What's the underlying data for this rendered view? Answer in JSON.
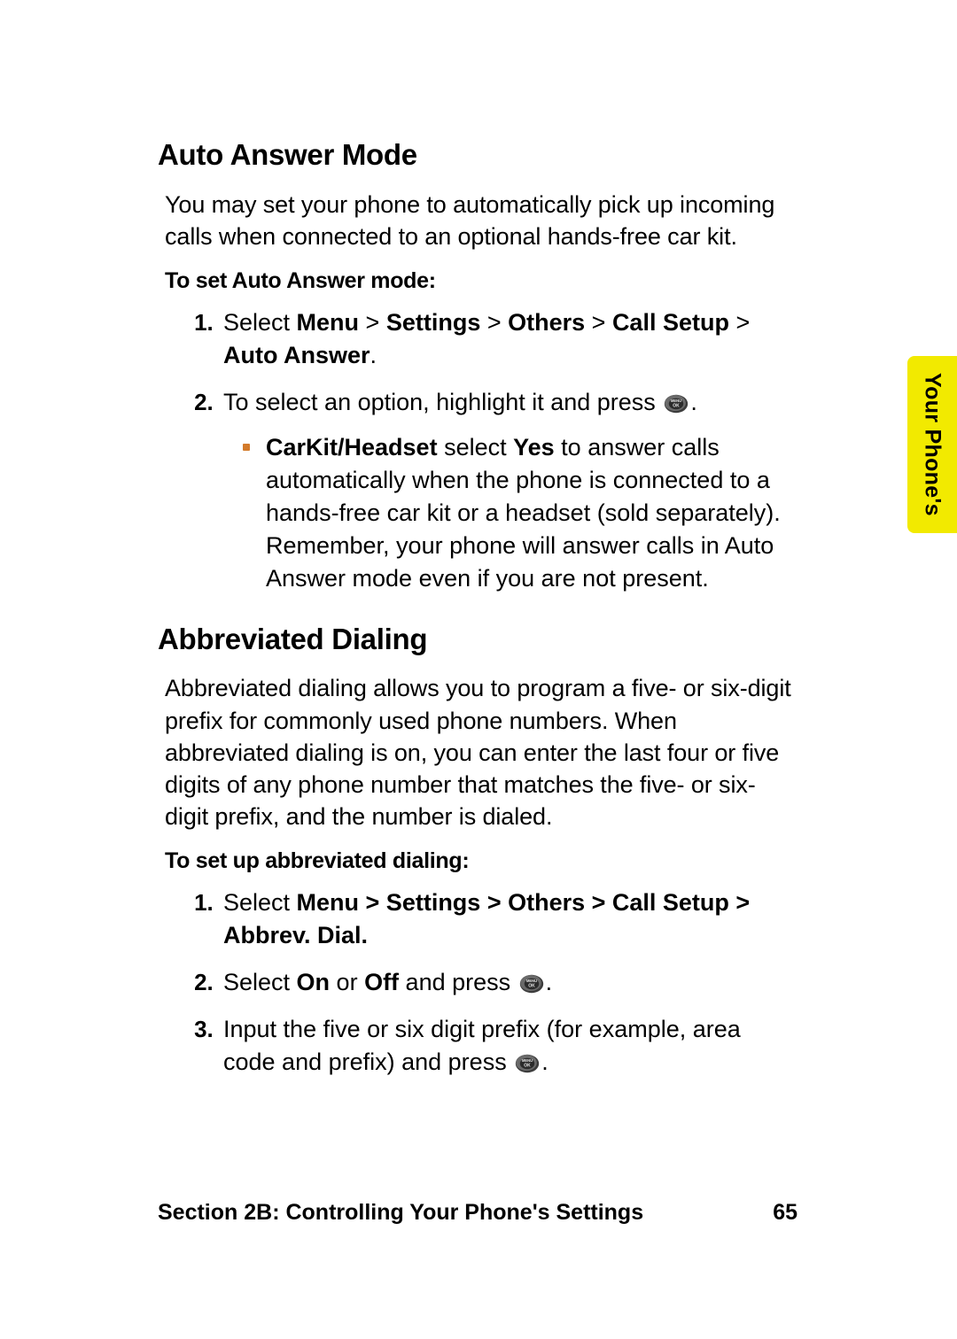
{
  "sideTab": {
    "label": "Your Phone's"
  },
  "section1": {
    "heading": "Auto Answer Mode",
    "intro": "You may set your phone to automatically pick up incoming calls when connected to an optional hands-free car kit.",
    "taskHeading": "To set Auto Answer mode:",
    "step1": {
      "pre": "Select ",
      "b1": "Menu",
      "b2": "Settings",
      "b3": "Others",
      "b4": "Call Setup",
      "b5": "Auto Answer",
      "dot": "."
    },
    "step2": {
      "pre": "To select an option, highlight it and press ",
      "post": "."
    },
    "bullet": {
      "b1": "CarKit/Headset",
      "mid1": " select ",
      "b2": "Yes",
      "rest": " to answer calls automatically when the phone is connected to a hands-free car kit or a headset (sold separately). Remember, your phone will answer calls in Auto Answer mode even if you are not present."
    }
  },
  "section2": {
    "heading": "Abbreviated Dialing",
    "intro": "Abbreviated dialing allows you to program a five- or six-digit prefix for commonly used phone numbers. When abbreviated dialing is on, you can enter the last four or five digits of any phone number that matches the five- or six-digit prefix, and the number is dialed.",
    "taskHeading": "To set up abbreviated dialing:",
    "step1": {
      "pre": "Select ",
      "bold": "Menu > Settings > Others > Call Setup > Abbrev. Dial."
    },
    "step2": {
      "pre": "Select ",
      "b1": "On",
      "mid": " or ",
      "b2": "Off",
      "post": " and press ",
      "dot": "."
    },
    "step3": {
      "pre": "Input the five or six digit prefix (for example, area code and prefix) and press ",
      "dot": "."
    }
  },
  "footer": {
    "section": "Section 2B: Controlling Your Phone's Settings",
    "page": "65"
  },
  "icons": {
    "menuOk": "menu-ok-button"
  }
}
